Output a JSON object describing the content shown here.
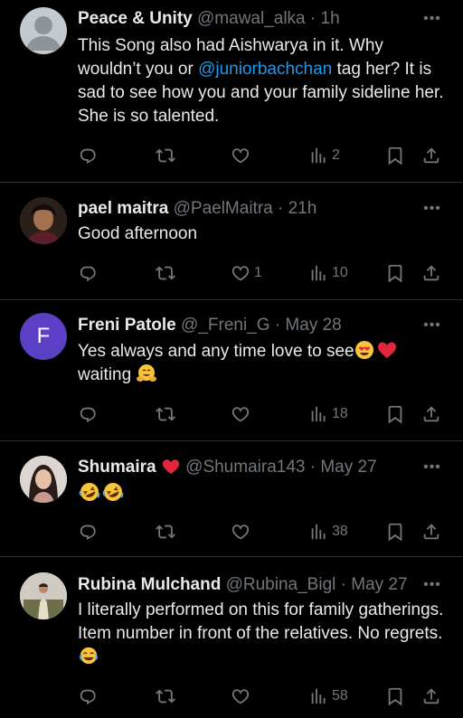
{
  "tweets": [
    {
      "name": "Peace & Unity",
      "handle": "@mawal_alka",
      "sep": " · ",
      "time": "1h",
      "text_parts": [
        "This Song also had Aishwarya in it.  Why wouldn’t you or ",
        "@juniorbachchan",
        " tag her?  It is sad to see how you  and your family sideline her.  She is so talented."
      ],
      "likes": "",
      "views": "2"
    },
    {
      "name": "pael maitra",
      "handle": "@PaelMaitra",
      "sep": " · ",
      "time": "21h",
      "text": "Good afternoon",
      "likes": "1",
      "views": "10"
    },
    {
      "name": "Freni Patole",
      "handle": "@_Freni_G",
      "sep": " · ",
      "time": "May 28",
      "avatar_letter": "F",
      "text_a": "Yes always and any time love to see",
      "text_b": "waiting",
      "likes": "",
      "views": "18"
    },
    {
      "name": "Shumaira",
      "handle": "@Shumaira143",
      "sep": " · ",
      "time": "May 27",
      "likes": "",
      "views": "38"
    },
    {
      "name": "Rubina Mulchand",
      "handle": "@Rubina_Bigl",
      "sep": " · ",
      "time": "May 27",
      "text": "I literally performed on this for family gatherings. Item number in front of the relatives. No regrets.",
      "likes": "",
      "views": "58"
    }
  ],
  "icons": {
    "reply": "reply-icon",
    "retweet": "retweet-icon",
    "like": "heart-icon",
    "views": "views-icon",
    "bookmark": "bookmark-icon",
    "share": "share-icon",
    "more": "more-icon"
  },
  "colors": {
    "background": "#000000",
    "text": "#e7e9ea",
    "muted": "#71767b",
    "link": "#1d9bf0",
    "divider": "#2f3336",
    "freni_avatar": "#5b3fc4"
  },
  "more_glyph": "•••"
}
